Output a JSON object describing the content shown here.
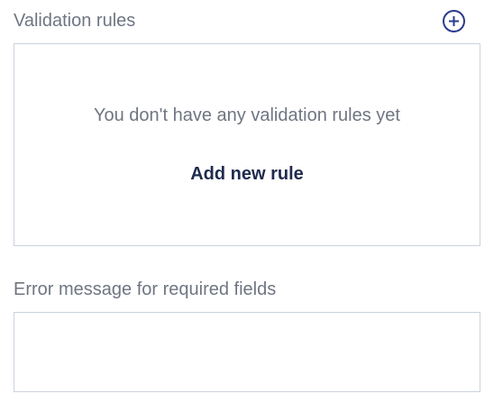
{
  "validation": {
    "label": "Validation rules",
    "add_icon": "add-circle-icon",
    "empty_message": "You don't have any validation rules yet",
    "add_rule_label": "Add new rule"
  },
  "error_message": {
    "label": "Error message for required fields",
    "value": ""
  },
  "colors": {
    "label_text": "#6f7582",
    "link_text": "#1f2b4d",
    "icon": "#2a3b8f",
    "border": "#ccd3df"
  }
}
